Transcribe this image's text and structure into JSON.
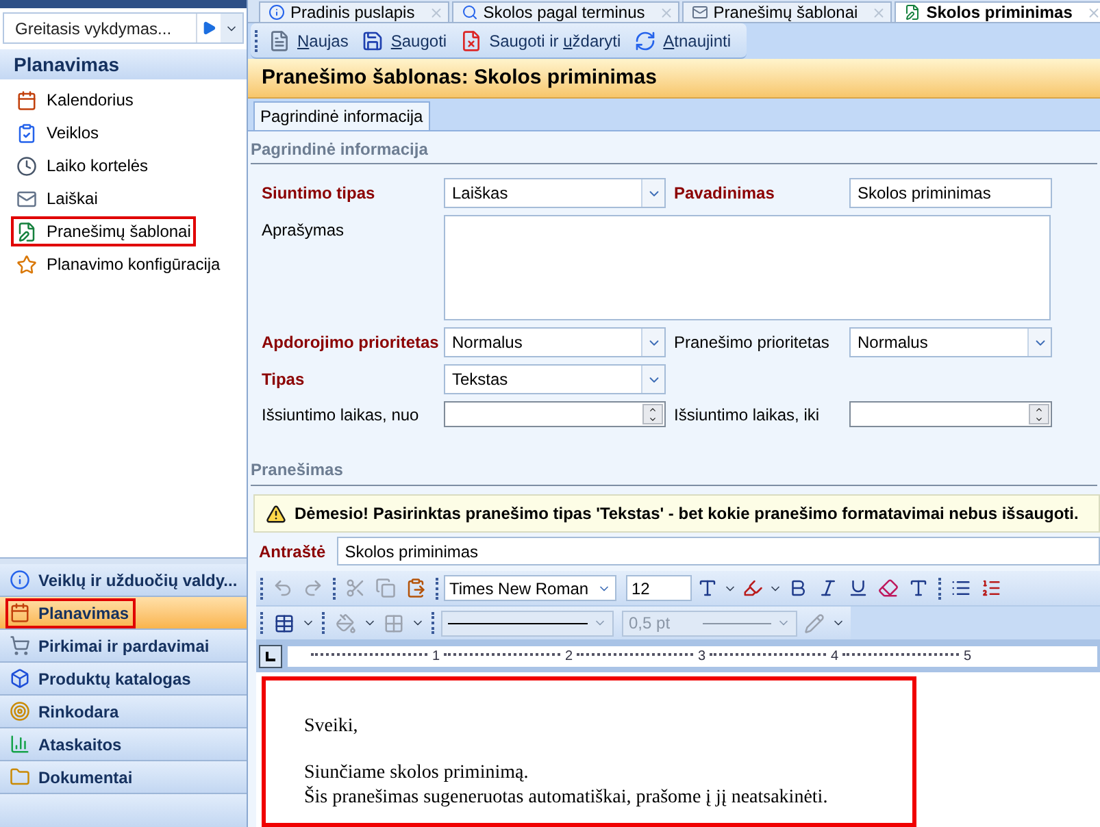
{
  "navigation": {
    "quick_run": {
      "value": "Greitasis vykdymas..."
    },
    "group_title": "Planavimas",
    "items": [
      {
        "label": "Kalendorius",
        "highlighted": false
      },
      {
        "label": "Veiklos",
        "highlighted": false
      },
      {
        "label": "Laiko kortelės",
        "highlighted": false
      },
      {
        "label": "Laiškai",
        "highlighted": false
      },
      {
        "label": "Pranešimų šablonai",
        "highlighted": true
      },
      {
        "label": "Planavimo konfigūracija",
        "highlighted": false
      }
    ],
    "modules": [
      {
        "label": "Veiklų ir užduočių valdy...",
        "selected": false,
        "highlighted": false
      },
      {
        "label": "Planavimas",
        "selected": true,
        "highlighted": true
      },
      {
        "label": "Pirkimai ir pardavimai",
        "selected": false,
        "highlighted": false
      },
      {
        "label": "Produktų katalogas",
        "selected": false,
        "highlighted": false
      },
      {
        "label": "Rinkodara",
        "selected": false,
        "highlighted": false
      },
      {
        "label": "Ataskaitos",
        "selected": false,
        "highlighted": false
      },
      {
        "label": "Dokumentai",
        "selected": false,
        "highlighted": false
      }
    ]
  },
  "document_tabs": [
    {
      "label": "Pradinis puslapis",
      "selected": false
    },
    {
      "label": "Skolos pagal terminus",
      "selected": false
    },
    {
      "label": "Pranešimų šablonai",
      "selected": false
    },
    {
      "label": "Skolos priminimas",
      "selected": true
    }
  ],
  "toolbar": [
    {
      "key": "N",
      "after": "aujas"
    },
    {
      "key": "S",
      "after": "augoti"
    },
    {
      "before": "Saugoti ir ",
      "key": "u",
      "after": "ždaryti"
    },
    {
      "key": "A",
      "after": "tnaujinti"
    }
  ],
  "title": "Pranešimo šablonas: Skolos priminimas",
  "form_tabs": [
    {
      "label": "Pagrindinė informacija",
      "selected": true
    }
  ],
  "main_section": {
    "title": "Pagrindinė informacija",
    "rows": [
      {
        "fields": [
          {
            "label": "Siuntimo tipas",
            "required": true,
            "kind": "combo",
            "value": "Laiškas"
          },
          {
            "label": "Pavadinimas",
            "required": true,
            "kind": "text",
            "value": "Skolos priminimas"
          }
        ]
      },
      {
        "fields": [
          {
            "label": "Aprašymas",
            "required": false,
            "kind": "textarea"
          }
        ]
      },
      {
        "fields": [
          {
            "label": "Apdorojimo prioritetas",
            "required": true,
            "kind": "combo",
            "value": "Normalus"
          },
          {
            "label": "Pranešimo prioritetas",
            "required": false,
            "kind": "combo",
            "value": "Normalus"
          }
        ]
      },
      {
        "fields": [
          {
            "label": "Tipas",
            "required": true,
            "kind": "combo",
            "value": "Tekstas"
          }
        ]
      },
      {
        "fields": [
          {
            "label": "Išsiuntimo laikas, nuo",
            "required": false,
            "kind": "spin"
          },
          {
            "label": "Išsiuntimo laikas, iki",
            "required": false,
            "kind": "spin"
          }
        ]
      }
    ]
  },
  "message_section": {
    "title": "Pranešimas",
    "warning": "Dėmesio! Pasirinktas pranešimo tipas 'Tekstas' - bet kokie pranešimo formatavimai nebus išsaugoti.",
    "subject": {
      "label": "Antraštė",
      "required": true,
      "value": "Skolos priminimas"
    },
    "editor": {
      "font": "Times New Roman",
      "size": "12",
      "line_width": {
        "value": "0,5 pt",
        "disabled": true
      },
      "ruler_labels": [
        "1",
        "2",
        "3",
        "4",
        "5"
      ],
      "highlighted": true,
      "paragraphs": [
        [
          "Sveiki,"
        ],
        [
          "Siunčiame skolos priminimą.",
          "Šis pranešimas sugeneruotas automatiškai, prašome į jį neatsakinėti."
        ]
      ]
    }
  }
}
